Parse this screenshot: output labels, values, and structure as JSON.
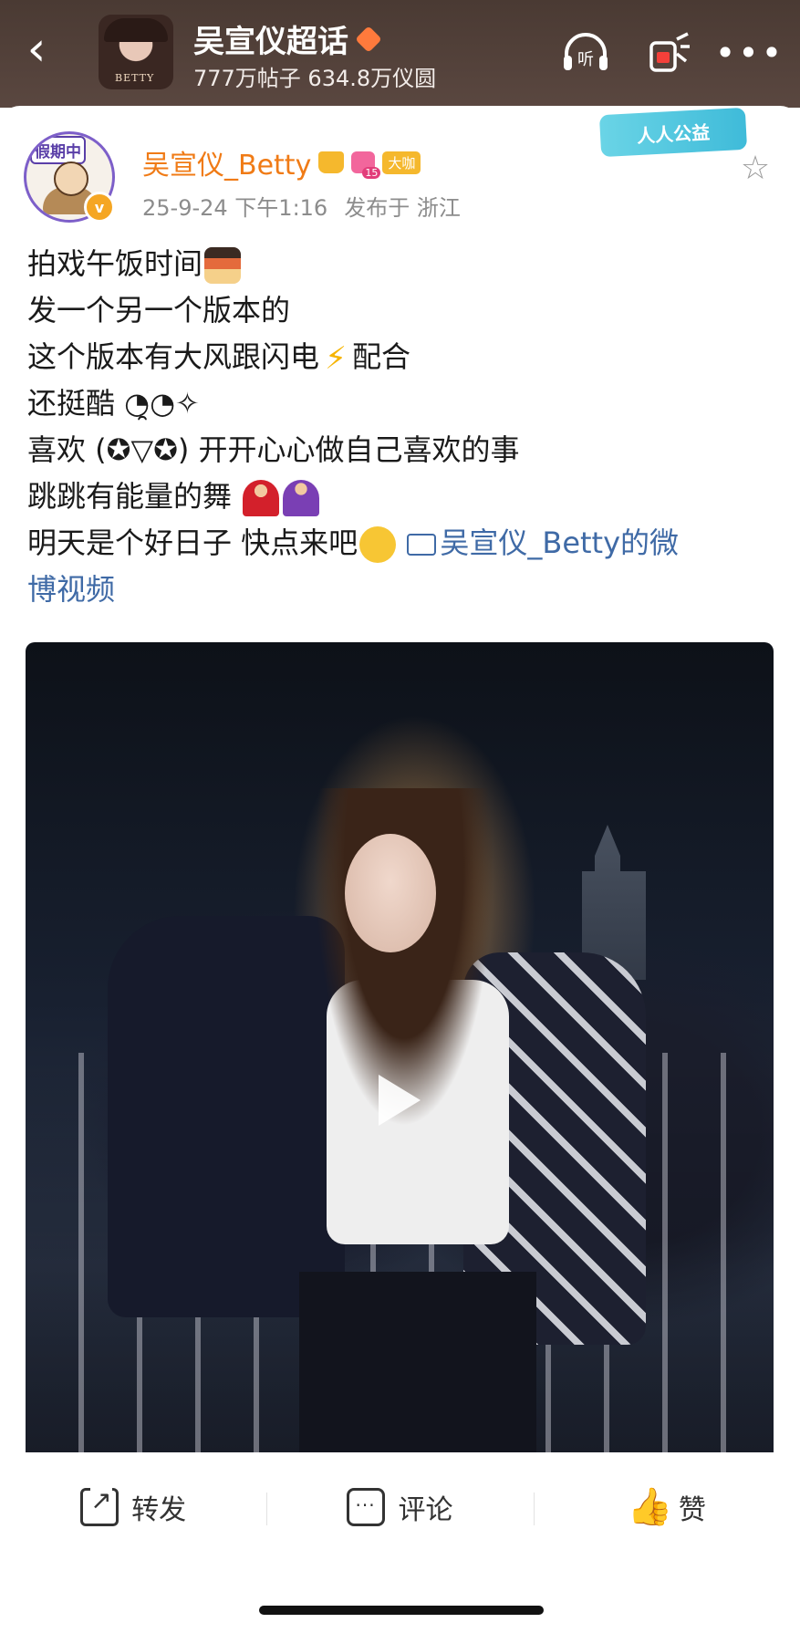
{
  "header": {
    "back_label": "<",
    "title": "吴宣仪超话",
    "level_badge_color": "#ff7a3c",
    "stats": "777万帖子 634.8万仪圆",
    "avatar_tag": "BETTY",
    "icons": [
      "listen-icon",
      "gift-icon",
      "more-icon"
    ]
  },
  "post": {
    "avatar_badge": "假期中",
    "username": "吴宣仪_Betty",
    "level": "15",
    "tag": "大咖",
    "date": "25-9-24 下午1:16",
    "location": "发布于 浙江",
    "charity_label": "人人公益",
    "lines": [
      "拍戏午饭时间",
      "发一个另一个版本的",
      "这个版本有大风跟闪电",
      "配合",
      "还挺酷 ◔̯◔✧",
      "喜欢 (✪▽✪) 开开心心做自己喜欢的事",
      "跳跳有能量的舞",
      "明天是个好日子 快点来吧",
      "吴宣仪_Betty的微",
      "博视频"
    ]
  },
  "actions": {
    "repost": "转发",
    "comment": "评论",
    "like": "赞"
  },
  "colors": {
    "username": "#f07b16",
    "link": "#3f6aa6",
    "header_bg": "#4a3a33"
  }
}
